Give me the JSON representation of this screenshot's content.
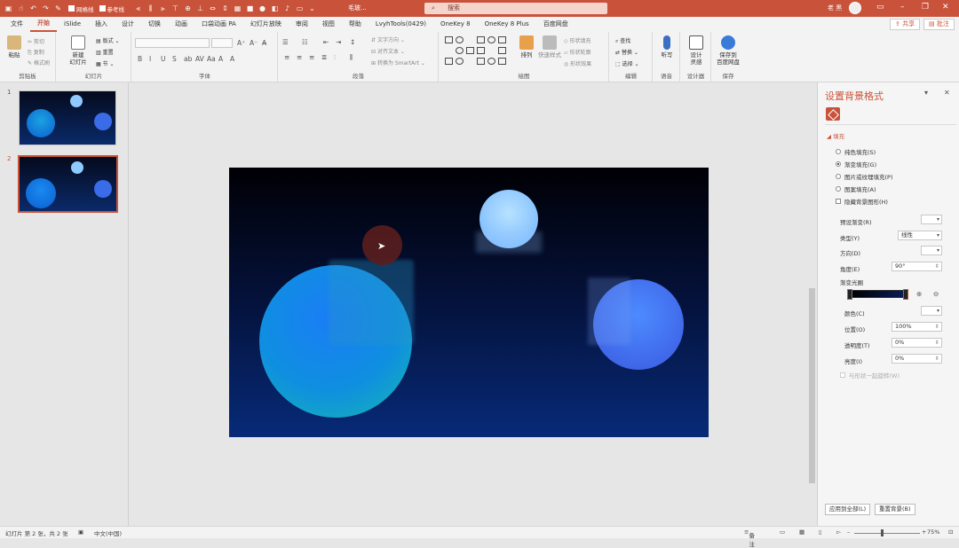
{
  "titlebar": {
    "checks": [
      "网格线",
      "参考线"
    ],
    "doc_title": "毛玻...",
    "search_placeholder": "搜索",
    "user_name": "老 黑",
    "min": "–",
    "restore": "❐",
    "close": "✕"
  },
  "tabs": [
    "文件",
    "开始",
    "iSlide",
    "插入",
    "设计",
    "切换",
    "动画",
    "口袋动画 PA",
    "幻灯片放映",
    "审阅",
    "视图",
    "帮助",
    "LvyhTools(0429)",
    "OneKey 8",
    "OneKey 8 Plus",
    "百度网盘"
  ],
  "active_tab": "开始",
  "share_label": "共享",
  "comment_label": "批注",
  "ribbon": {
    "clipboard": {
      "paste": "粘贴",
      "cut": "剪切",
      "copy": "复制",
      "painter": "格式刷",
      "label": "剪贴板"
    },
    "slides": {
      "new": "新建\n幻灯片",
      "layout": "版式",
      "reset": "重置",
      "section": "节",
      "label": "幻灯片"
    },
    "font": {
      "label": "字体",
      "buttons": [
        "B",
        "I",
        "U",
        "S",
        "ab",
        "AV",
        "Aa",
        "A",
        "A"
      ]
    },
    "paragraph": {
      "label": "段落",
      "text_direction": "文字方向",
      "align_text": "对齐文本",
      "smartart": "转换为 SmartArt"
    },
    "drawing": {
      "label": "绘图",
      "arrange": "排列",
      "quick_styles": "快速样式",
      "shape_fill": "形状填充",
      "shape_outline": "形状轮廓",
      "shape_effects": "形状效果"
    },
    "editing": {
      "label": "编辑",
      "find": "查找",
      "replace": "替换",
      "select": "选择"
    },
    "voice": {
      "dictate": "听写",
      "label": "语音"
    },
    "designer": {
      "ideas": "设计\n灵感",
      "label": "设计器"
    },
    "save": {
      "save_baidu": "保存到\n百度网盘",
      "label": "保存"
    }
  },
  "slides_panel": {
    "numbers": [
      "1",
      "2"
    ],
    "selected": "2"
  },
  "format_pane": {
    "title": "设置背景格式",
    "section": "填充",
    "options": [
      "纯色填充(S)",
      "渐变填充(G)",
      "图片或纹理填充(P)",
      "图案填充(A)"
    ],
    "selected_option": "渐变填充(G)",
    "hide_bg": "隐藏背景图形(H)",
    "preset_label": "预设渐变(R)",
    "type_label": "类型(Y)",
    "type_value": "线性",
    "direction_label": "方向(D)",
    "angle_label": "角度(E)",
    "angle_value": "90°",
    "stops_label": "渐变光圈",
    "color_label": "颜色(C)",
    "position_label": "位置(O)",
    "position_value": "100%",
    "transparency_label": "透明度(T)",
    "transparency_value": "0%",
    "brightness_label": "亮度(I)",
    "brightness_value": "0%",
    "rotate_label": "与形状一起旋转(W)",
    "apply_all": "应用到全部(L)",
    "reset_bg": "重置背景(B)"
  },
  "status": {
    "slide_info": "幻灯片 第 2 张，共 2 张",
    "language": "中文(中国)",
    "notes": "备注",
    "zoom": "75%"
  },
  "colors": {
    "accent": "#c9533a"
  }
}
